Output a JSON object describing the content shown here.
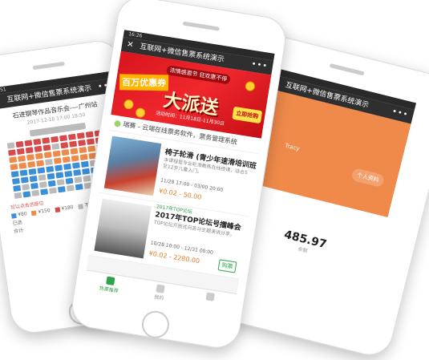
{
  "common": {
    "window_title": "互联网+微信售票系统演示",
    "close_label": "✕",
    "more_label": "•••"
  },
  "phone1": {
    "status_time": "16:51",
    "concert_title": "石进钢琴作品音乐会-—广州站",
    "concert_time": "2017-12-18 17:00 18:50",
    "legend_hint": "可以点击选座位",
    "legend_items": [
      {
        "label": "¥80",
        "color": "#3a8fd8"
      },
      {
        "label": "¥150",
        "color": "#f08a4b"
      },
      {
        "label": "¥180",
        "color": "#d84a4a"
      },
      {
        "label": "不可售",
        "color": "#bbbbbb"
      }
    ],
    "footer_left": "已选",
    "footer_left2": "合计"
  },
  "phone2": {
    "status_time": "16:26",
    "banner": {
      "top_text": "浓情感恩节 狂欢惠不停",
      "left_text": "百万优惠券",
      "big_text": "大派送",
      "sub_text": "活动时间：11月18日-11月30日",
      "badge": "立即抢购"
    },
    "notice": "瑞赛 - 云端在线票务软件，票务管理系统",
    "events": [
      {
        "tag": "",
        "name": "椅子轮滑 (青少年速滑培训班)",
        "desc": "本课程是专业轮滑教练在线授课，适合5至12岁儿童入门。",
        "date": "11/28 17:00 - 03/00 20:00",
        "price": "¥0.02 - 50.00",
        "status": ""
      },
      {
        "tag": "2017年TOP论坛",
        "name": "2017年TOP论坛号擂峰会",
        "desc": "TOP论坛开放式问答与主题演讲分享。",
        "date": "10/28 10:00 - 12/31 00:00",
        "price": "¥0.02 - 2280.00",
        "status": "购票"
      }
    ],
    "tabs": [
      {
        "label": "热票推荐"
      },
      {
        "label": "我的"
      },
      {
        "label": ""
      }
    ]
  },
  "phone3": {
    "status_time": "",
    "profile_chip": "个人资料",
    "name_tag": "Tracy",
    "balance": "485.97",
    "balance_label": "余额"
  }
}
